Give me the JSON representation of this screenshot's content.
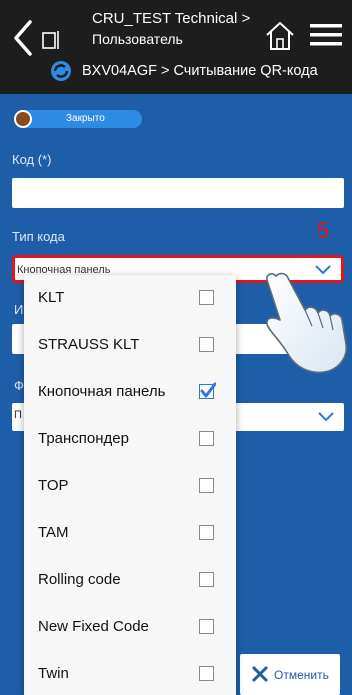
{
  "header": {
    "title_line1": "CRU_TEST Technical >",
    "title_line2": "Пользователь",
    "subtitle": "BXV04AGF > Считывание QR-кода"
  },
  "status": {
    "label": "Закрыто",
    "color": "#8a4a1c"
  },
  "form": {
    "code_label": "Код (*)",
    "code_value": "",
    "code_type_label": "Тип кода",
    "code_type_value": "Кнопочная панель",
    "hidden_label_1": "И",
    "hidden_label_2": "Ф",
    "hidden_value_3": "П"
  },
  "annotation": {
    "step": "5"
  },
  "dropdown": {
    "options": [
      {
        "label": "KLT",
        "checked": false
      },
      {
        "label": "STRAUSS KLT",
        "checked": false
      },
      {
        "label": "Кнопочная панель",
        "checked": true
      },
      {
        "label": "Транспондер",
        "checked": false
      },
      {
        "label": "TOP",
        "checked": false
      },
      {
        "label": "TAM",
        "checked": false
      },
      {
        "label": "Rolling code",
        "checked": false
      },
      {
        "label": "New Fixed Code",
        "checked": false
      },
      {
        "label": "Twin",
        "checked": false
      }
    ]
  },
  "footer": {
    "cancel_label": "Отменить"
  },
  "colors": {
    "background": "#1e5ea9",
    "header": "#1d1d1d",
    "accent": "#2d8be3",
    "highlight": "#e0161b"
  }
}
